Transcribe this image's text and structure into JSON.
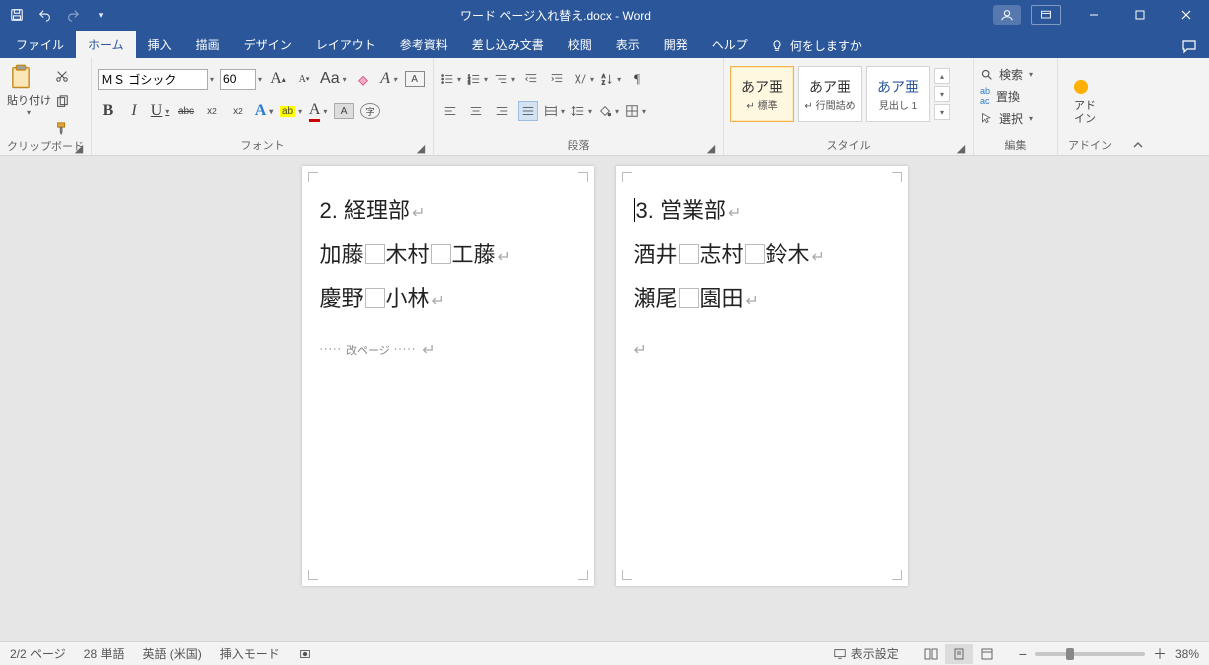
{
  "titlebar": {
    "title": "ワード ページ入れ替え.docx  -  Word"
  },
  "tabs": {
    "file": "ファイル",
    "items": [
      "ホーム",
      "挿入",
      "描画",
      "デザイン",
      "レイアウト",
      "参考資料",
      "差し込み文書",
      "校閲",
      "表示",
      "開発",
      "ヘルプ"
    ],
    "active_index": 0,
    "tell_me": "何をしますか"
  },
  "ribbon": {
    "clipboard": {
      "label": "クリップボード",
      "paste": "貼り付け"
    },
    "font": {
      "label": "フォント",
      "name": "ＭＳ ゴシック",
      "size": "60",
      "bold": "B",
      "italic": "I",
      "underline": "U"
    },
    "paragraph": {
      "label": "段落"
    },
    "styles": {
      "label": "スタイル",
      "items": [
        {
          "preview": "あア亜",
          "name": "↵ 標準"
        },
        {
          "preview": "あア亜",
          "name": "↵ 行間詰め"
        },
        {
          "preview": "あア亜",
          "name": "見出し 1"
        }
      ]
    },
    "editing": {
      "label": "編集",
      "find": "検索",
      "replace": "置換",
      "select": "選択"
    },
    "addin": {
      "label": "アドイン",
      "btn1": "アド",
      "btn2": "イン"
    }
  },
  "document": {
    "pages": [
      {
        "title": "2. 経理部",
        "line2_parts": [
          "加藤",
          "木村",
          "工藤"
        ],
        "line3_parts": [
          "慶野",
          "小林"
        ],
        "pagebreak_label": "改ページ"
      },
      {
        "title": "3. 営業部",
        "line2_parts": [
          "酒井",
          "志村",
          "鈴木"
        ],
        "line3_parts": [
          "瀬尾",
          "園田"
        ]
      }
    ]
  },
  "status": {
    "page": "2/2 ページ",
    "words": "28 単語",
    "lang": "英語 (米国)",
    "mode": "挿入モード",
    "display_settings": "表示設定",
    "zoom": "38%"
  }
}
